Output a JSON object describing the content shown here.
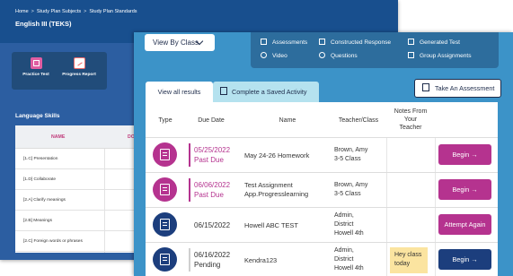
{
  "back": {
    "breadcrumb": [
      "Home",
      "Study Plan Subjects",
      "Study Plan Standards"
    ],
    "breadcrumb_sep": ">",
    "title": "English III (TEKS)",
    "tools": [
      {
        "label": "Practice Test",
        "icon": "practice-test-icon"
      },
      {
        "label": "Progress Report",
        "icon": "progress-report-icon"
      }
    ],
    "section_heading": "Language Skills",
    "table": {
      "headers": [
        "NAME",
        "DO"
      ],
      "rows": [
        "[1.C] Presentation",
        "[1.D] Collaborate",
        "[2.A] Clarify meanings",
        "[2.B] Meanings",
        "[2.C] Foreign words or phrases"
      ]
    }
  },
  "front": {
    "view_dropdown": "View By Class",
    "menu": {
      "row1": [
        "Assessments",
        "Constructed Response",
        "Generated Test"
      ],
      "row2": [
        "Video",
        "Questions",
        "Group Assignments"
      ]
    },
    "tabs": [
      "View all results",
      "Complete a Saved Activity"
    ],
    "take_assessment": "Take An Assessment",
    "columns": {
      "type": "Type",
      "due": "Due Date",
      "name": "Name",
      "teacher": "Teacher/Class",
      "notes": [
        "Notes From",
        "Your",
        "Teacher"
      ]
    },
    "rows": [
      {
        "type_color": "#b5338f",
        "due": "05/25/2022",
        "status": "Past Due",
        "name": [
          "May 24-26 Homework"
        ],
        "teacher": [
          "Brown, Amy",
          "3-5 Class"
        ],
        "note": "",
        "action": "Begin →",
        "action_color": "#b5338f"
      },
      {
        "type_color": "#b5338f",
        "due": "06/06/2022",
        "status": "Past Due",
        "name": [
          "Test Assignment",
          "App.Progresslearning"
        ],
        "teacher": [
          "Brown, Amy",
          "3-5 Class"
        ],
        "note": "",
        "action": "Begin →",
        "action_color": "#b5338f"
      },
      {
        "type_color": "#1c3e7d",
        "due": "06/15/2022",
        "status": "",
        "name": [
          "Howell ABC TEST"
        ],
        "teacher": [
          "Admin,",
          "District",
          "Howell 4th"
        ],
        "note": "",
        "action": "Attempt Again",
        "action_color": "#b5338f"
      },
      {
        "type_color": "#1c3e7d",
        "due": "06/16/2022",
        "status": "Pending",
        "name": [
          "Kendra123"
        ],
        "teacher": [
          "Admin,",
          "District",
          "Howell 4th"
        ],
        "note": [
          "Hey class",
          "today"
        ],
        "action": "Begin →",
        "action_color": "#1c3e7d"
      }
    ]
  }
}
